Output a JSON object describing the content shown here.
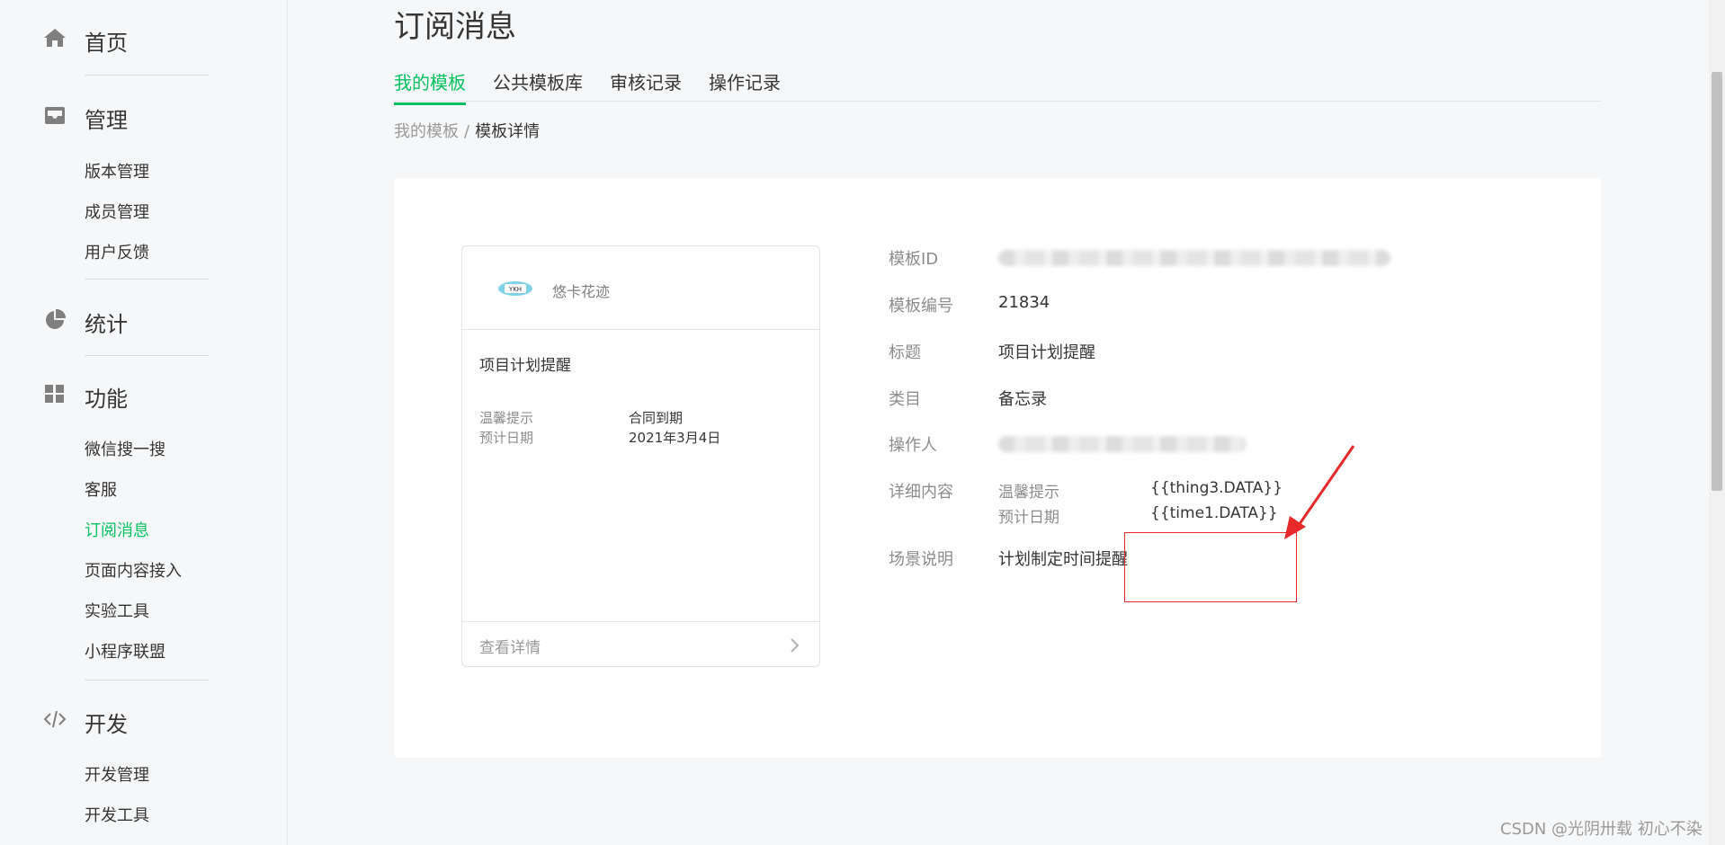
{
  "sidebar": {
    "home": {
      "label": "首页",
      "icon": "home-icon"
    },
    "manage": {
      "label": "管理",
      "icon": "inbox-icon",
      "items": [
        "版本管理",
        "成员管理",
        "用户反馈"
      ]
    },
    "stats": {
      "label": "统计",
      "icon": "pie-chart-icon"
    },
    "features": {
      "label": "功能",
      "icon": "grid-icon",
      "items": [
        "微信搜一搜",
        "客服",
        "订阅消息",
        "页面内容接入",
        "实验工具",
        "小程序联盟"
      ],
      "active_item": "订阅消息"
    },
    "develop": {
      "label": "开发",
      "icon": "code-icon",
      "items": [
        "开发管理",
        "开发工具"
      ]
    }
  },
  "page": {
    "title": "订阅消息",
    "tabs": [
      {
        "label": "我的模板",
        "active": true
      },
      {
        "label": "公共模板库",
        "active": false
      },
      {
        "label": "审核记录",
        "active": false
      },
      {
        "label": "操作记录",
        "active": false
      }
    ],
    "breadcrumb": {
      "parent": "我的模板",
      "separator": "/",
      "current": "模板详情"
    }
  },
  "preview": {
    "app_name": "悠卡花迹",
    "title": "项目计划提醒",
    "fields": [
      {
        "key": "温馨提示",
        "value": "合同到期"
      },
      {
        "key": "预计日期",
        "value": "2021年3月4日"
      }
    ],
    "footer_label": "查看详情"
  },
  "detail": {
    "template_id_label": "模板ID",
    "template_no_label": "模板编号",
    "template_no": "21834",
    "title_label": "标题",
    "title": "项目计划提醒",
    "category_label": "类目",
    "category": "备忘录",
    "operator_label": "操作人",
    "content_label": "详细内容",
    "content": [
      {
        "key": "温馨提示",
        "value": "{{thing3.DATA}}"
      },
      {
        "key": "预计日期",
        "value": "{{time1.DATA}}"
      }
    ],
    "scene_label": "场景说明",
    "scene": "计划制定时间提醒"
  },
  "watermark": "CSDN @光阴卅载 初心不染",
  "colors": {
    "accent": "#07c160",
    "annotation": "#e8292b"
  }
}
